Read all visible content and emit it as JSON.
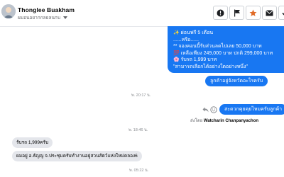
{
  "header": {
    "contact_name": "Thonglee Buakham",
    "contact_sub": "ผมอนอยากกลยลนกบ",
    "buttons": [
      "info",
      "flag",
      "star",
      "mail",
      "check"
    ]
  },
  "messages": {
    "outgoing_big": [
      "✨ ผ่อนฟรี 5 เดือน",
      "......หรือ......",
      "** จองคอนนี้รับส่วนลดไปเลย 50,000 บาท",
      "💯 เหลือเพียง 249,000 บาท ปกติ 299,000 บาท",
      "🌸 รับรถ 1,999 บาท",
      "\"สามารถเลือกได้อย่างใดอย่างหนึ่ง\""
    ],
    "outgoing_q1": "ลูกค้าอยู่จังหวัดอะไรครับ",
    "timestamp_1": "พ. 20:17 น.",
    "outgoing_q2": "สะดวกคุยคุยไหมครับลูกค้า",
    "sent_by_prefix": "ส่งโดย",
    "sent_by_name": "Watcharin Chanpanyachon",
    "timestamp_2": "พ. 18:46 น.",
    "incoming_1": "รับรถ 1,999ครับ",
    "incoming_2": "ผมอยู่ อ.ธัญญ จ.ประชุมครับทำงานอยู่สวนสัตว์แห่งใหม่คลอง6",
    "timestamp_3": "พ. 05:22 น."
  },
  "colors": {
    "outgoing_bubble": "#1877f2",
    "incoming_bubble": "#e4e6eb",
    "star_button": "#e06b27"
  }
}
